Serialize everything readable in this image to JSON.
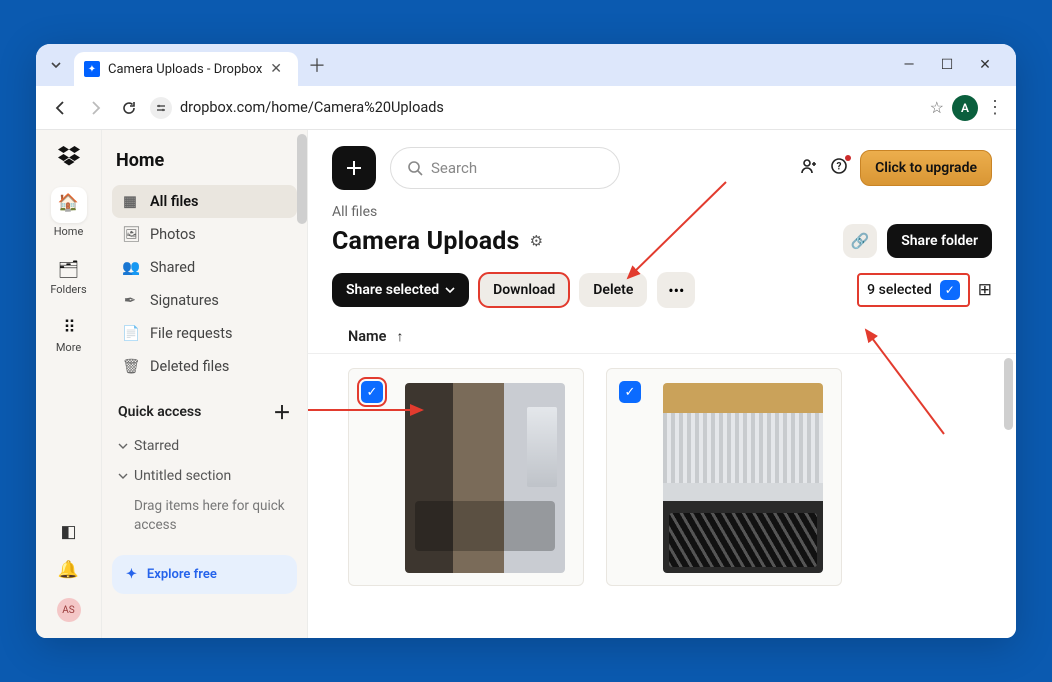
{
  "browser": {
    "tab_title": "Camera Uploads - Dropbox",
    "url": "dropbox.com/home/Camera%20Uploads",
    "profile_initial": "A"
  },
  "rail": {
    "items": [
      {
        "icon": "🏠",
        "label": "Home"
      },
      {
        "icon": "🗂",
        "label": "Folders"
      },
      {
        "icon": "⋮⋮⋮",
        "label": "More"
      }
    ],
    "avatar": "AS"
  },
  "sidebar": {
    "title": "Home",
    "items": [
      {
        "icon": "▦",
        "label": "All files",
        "selected": true
      },
      {
        "icon": "🖼",
        "label": "Photos"
      },
      {
        "icon": "👥",
        "label": "Shared"
      },
      {
        "icon": "✒︎",
        "label": "Signatures"
      },
      {
        "icon": "📄",
        "label": "File requests"
      },
      {
        "icon": "🗑",
        "label": "Deleted files"
      }
    ],
    "quick_access": "Quick access",
    "starred": "Starred",
    "untitled": "Untitled section",
    "drag_hint": "Drag items here for quick access",
    "explore": "Explore free"
  },
  "header": {
    "search_placeholder": "Search",
    "upgrade": "Click to upgrade"
  },
  "breadcrumb": {
    "all_files": "All files"
  },
  "folder": {
    "title": "Camera Uploads",
    "share": "Share folder"
  },
  "toolbar": {
    "share_selected": "Share selected",
    "download": "Download",
    "delete": "Delete",
    "selected": "9 selected"
  },
  "list": {
    "col_name": "Name"
  }
}
